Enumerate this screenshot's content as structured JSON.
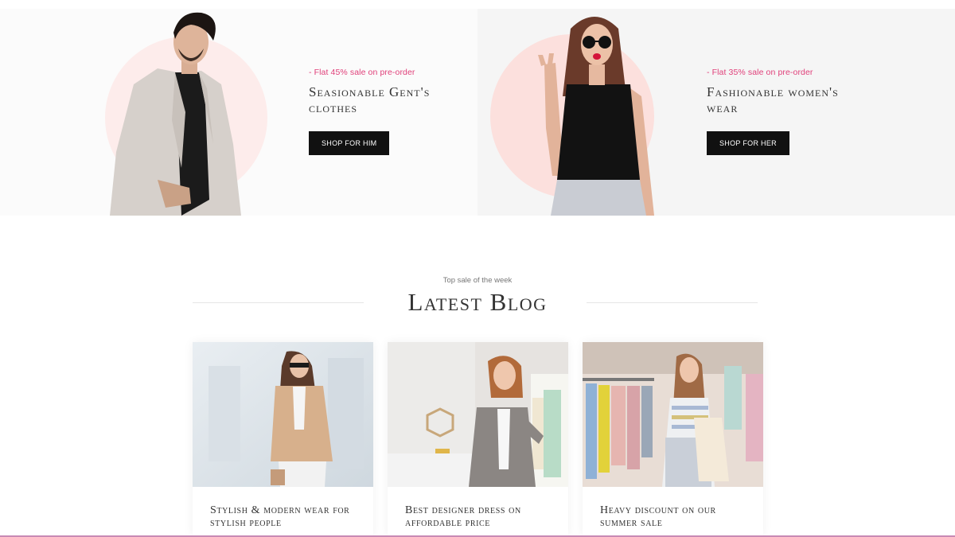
{
  "promos": [
    {
      "tag": "- Flat 45% sale on pre-order",
      "title": "Seasionable Gent's clothes",
      "button": "SHOP FOR HIM"
    },
    {
      "tag": "- Flat 35% sale on pre-order",
      "title": "Fashionable women's wear",
      "button": "SHOP FOR HER"
    }
  ],
  "blog": {
    "subtitle": "Top sale of the week",
    "title": "Latest Blog",
    "posts": [
      {
        "title": "Stylish & modern wear for stylish people"
      },
      {
        "title": "Best designer dress on affordable price"
      },
      {
        "title": "Heavy discount on our summer sale"
      }
    ]
  },
  "colors": {
    "accent": "#e0407a",
    "button_bg": "#111111",
    "underline": "#c88ab5"
  }
}
